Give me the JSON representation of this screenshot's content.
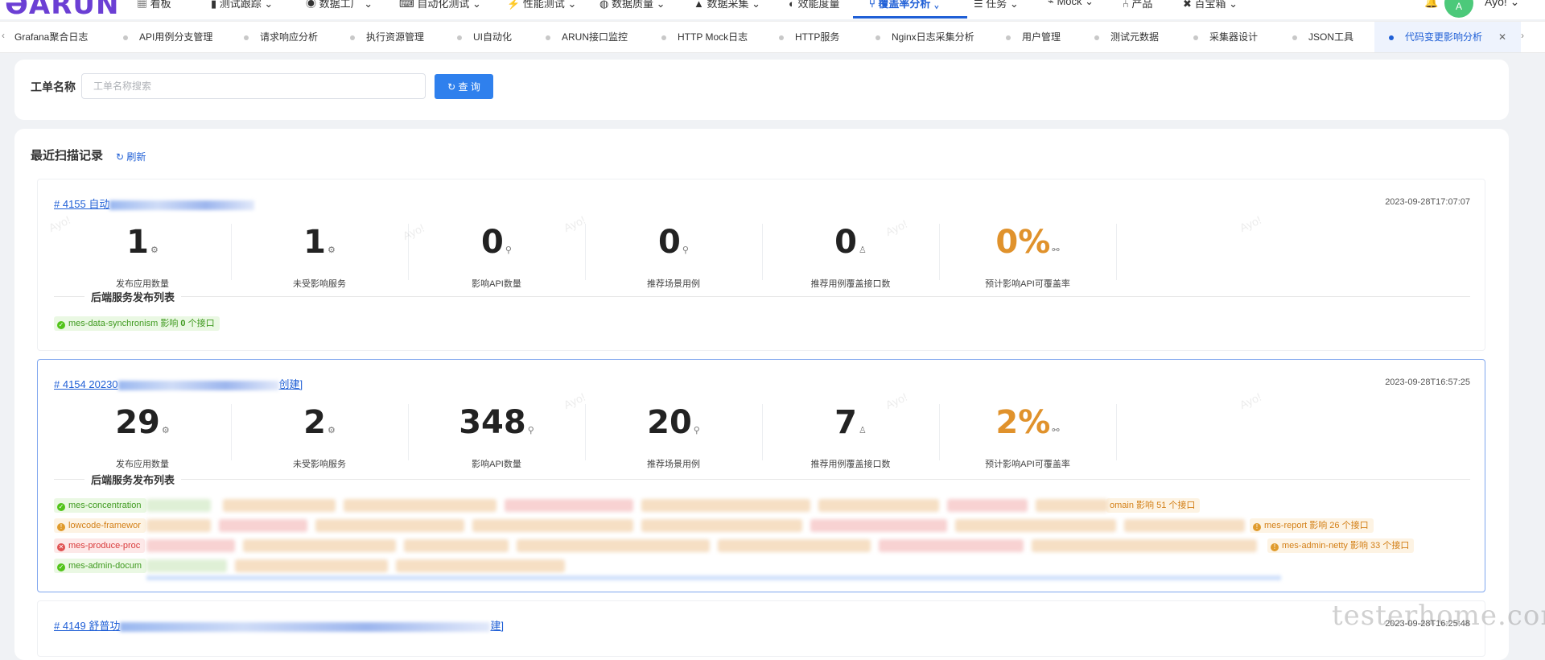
{
  "brand": {
    "logo_text": "ARUN"
  },
  "nav": {
    "items": [
      "看板",
      "测试跟踪",
      "数据工厂",
      "自动化测试",
      "性能测试",
      "数据质量",
      "数据采集",
      "效能度量",
      "覆盖率分析",
      "任务",
      "Mock",
      "产品",
      "百宝箱"
    ],
    "active": "覆盖率分析",
    "user": "Ayo!"
  },
  "tabs": [
    "Grafana聚合日志",
    "API用例分支管理",
    "请求响应分析",
    "执行资源管理",
    "UI自动化",
    "ARUN接口监控",
    "HTTP Mock日志",
    "HTTP服务",
    "Nginx日志采集分析",
    "用户管理",
    "测试元数据",
    "采集器设计",
    "JSON工具",
    "代码变更影响分析"
  ],
  "search": {
    "label": "工单名称",
    "placeholder": "工单名称搜索",
    "button": "查 询"
  },
  "section": {
    "title": "最近扫描记录",
    "refresh": "刷新"
  },
  "stat_labels": [
    "发布应用数量",
    "未受影响服务",
    "影响API数量",
    "推荐场景用例",
    "推荐用例覆盖接口数",
    "预计影响API可覆盖率"
  ],
  "records": [
    {
      "title_prefix": "# 4155 自动",
      "time": "2023-09-28T17:07:07",
      "stats": [
        "1",
        "1",
        "0",
        "0",
        "0",
        "0%"
      ],
      "list_title": "后端服务发布列表",
      "tags": [
        {
          "name": "mes-data-synchronism",
          "text_before": "影响",
          "count": "0",
          "unit": "个接口",
          "color": "green"
        }
      ]
    },
    {
      "title_prefix": "# 4154 20230",
      "title_suffix": "创建]",
      "time": "2023-09-28T16:57:25",
      "stats": [
        "29",
        "2",
        "348",
        "20",
        "7",
        "2%"
      ],
      "list_title": "后端服务发布列表",
      "tags_visible": {
        "row1_left": "mes-concentration",
        "row1_right": "omain 影响 51 个接口",
        "row2_left": "lowcode-framewor",
        "row2_right": "mes-report 影响 26 个接口",
        "row3_left": "mes-produce-proc",
        "row3_right": "mes-admin-netty 影响 33 个接口",
        "row4_left": "mes-admin-docum"
      }
    },
    {
      "title_prefix": "# 4149 舒普功",
      "title_suffix": "建]",
      "time": "2023-09-28T16:25:48"
    }
  ],
  "watermarks": {
    "user": "Ayo!",
    "site": "testerhome.com"
  }
}
